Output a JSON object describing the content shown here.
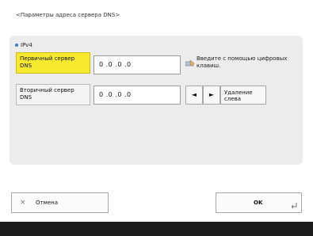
{
  "dialog": {
    "title": "<Параметры адреса сервера DNS>"
  },
  "section": {
    "label": "IPv4"
  },
  "fields": {
    "primary": {
      "label": "Первичный сервер DNS",
      "value": "0 .0 .0 .0"
    },
    "secondary": {
      "label": "Вторичный сервер DNS",
      "value": "0 .0 .0 .0"
    }
  },
  "hint": {
    "icon": "keypad-hand-icon",
    "text": "Введите с помощью цифровых клавиш."
  },
  "controls": {
    "left_arrow": "◄",
    "right_arrow": "►",
    "delete_label": "Удаление слева"
  },
  "footer": {
    "cancel_icon": "×",
    "cancel_label": "Отмена",
    "ok_label": "OK",
    "ok_corner_icon": "enter-corner-icon"
  },
  "colors": {
    "active_field": "#f7e830",
    "panel": "#ececec",
    "bottom_bar": "#1d1d1d"
  }
}
